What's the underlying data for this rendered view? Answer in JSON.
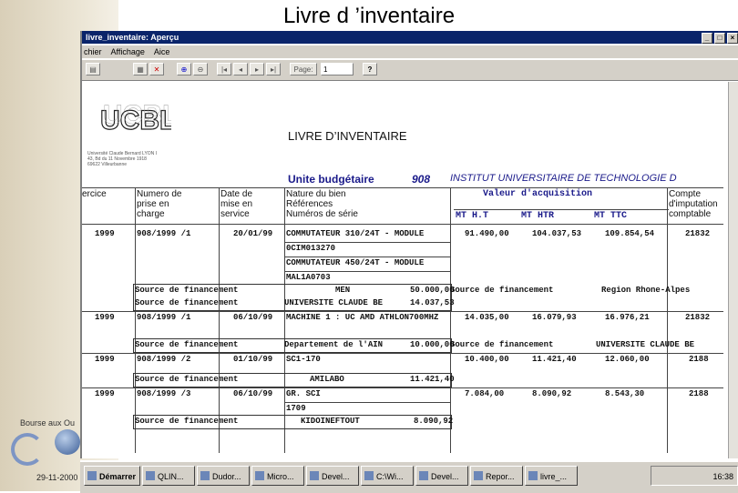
{
  "slide": {
    "title": "Livre d ’inventaire",
    "footer_text": "Bourse aux Ou",
    "footer_date": "29-11-2000"
  },
  "window": {
    "title": "livre_inventaire: Aperçu",
    "menu": [
      "chier",
      "Affichage",
      "Aice"
    ],
    "toolbar_page_label": "Page:",
    "toolbar_page_value": "1",
    "help_symbol": "?"
  },
  "document": {
    "title": "LIVRE D’INVENTAIRE",
    "logo_text": "UCBL",
    "address_lines": [
      "Université Claude Bernard LYON I",
      "43, Bd du 11 Novembre 1918",
      "69622 Villeurbanne"
    ],
    "unit_label": "Unite budgétaire",
    "unit_number": "908",
    "unit_name": "INSTITUT UNIVERSITAIRE DE TECHNOLOGIE D",
    "headers": {
      "exercice": "ercice",
      "numero": [
        "Numero de",
        "prise en",
        "charge"
      ],
      "date": [
        "Date de",
        "mise en",
        "service"
      ],
      "nature": [
        "Nature du bien",
        "Références",
        "Numéros de série"
      ],
      "valeur": "Valeur d'acquisition",
      "mt_ht": "MT H.T",
      "mt_htr": "MT HTR",
      "mt_ttc": "MT TTC",
      "compte": [
        "Compte",
        "d'imputation",
        "comptable"
      ]
    },
    "rows": [
      {
        "year": "1999",
        "num": "908/1999 /1",
        "date": "20/01/99",
        "nature": "COMMUTATEUR 310/24T - MODULE",
        "ht": "91.490,00",
        "htr": "104.037,53",
        "ttc": "109.854,54",
        "compte": "21832"
      },
      {
        "nature": "0CIM013270"
      },
      {
        "nature": "COMMUTATEUR 450/24T - MODULE"
      },
      {
        "nature": "MAL1A0703"
      },
      {
        "src_label": "Source de financement",
        "src_name": "MEN",
        "src_amount": "50.000,00",
        "src_label2": "Source de financement",
        "src_region": "Region Rhone-Alpes"
      },
      {
        "src_label": "Source de financement",
        "src_name": "UNIVERSITE CLAUDE BE",
        "src_amount": "14.037,53"
      },
      {
        "year": "1999",
        "num": "908/1999 /1",
        "date": "06/10/99",
        "nature": "MACHINE 1 : UC AMD ATHLON700MHZ",
        "ht": "14.035,00",
        "htr": "16.079,93",
        "ttc": "16.976,21",
        "compte": "21832"
      },
      {
        "src_label": "Source de financement",
        "src_name": "Departement de l'AIN",
        "src_amount": "10.000,00",
        "src_label2": "Source de financement",
        "src_region": "UNIVERSITE CLAUDE BE"
      },
      {
        "year": "1999",
        "num": "908/1999 /2",
        "date": "01/10/99",
        "nature": "SC1-170",
        "ht": "10.400,00",
        "htr": "11.421,40",
        "ttc": "12.060,00",
        "compte": "2188"
      },
      {
        "src_label": "Source de financement",
        "src_name": "AMILABO",
        "src_amount": "11.421,40"
      },
      {
        "year": "1999",
        "num": "908/1999 /3",
        "date": "06/10/99",
        "nature": "GR. SCI",
        "ht": "7.084,00",
        "htr": "8.090,92",
        "ttc": "8.543,30",
        "compte": "2188"
      },
      {
        "nature": "1709"
      },
      {
        "src_label": "Source de financement",
        "src_name": "KIDOINEFTOUT",
        "src_amount": "8.090,92"
      }
    ]
  },
  "taskbar": {
    "start": "Démarrer",
    "items": [
      "QLIN...",
      "Dudor...",
      "Micro...",
      "Devel...",
      "C:\\Wi...",
      "Devel...",
      "Repor...",
      "livre_..."
    ],
    "clock": "16:38"
  }
}
